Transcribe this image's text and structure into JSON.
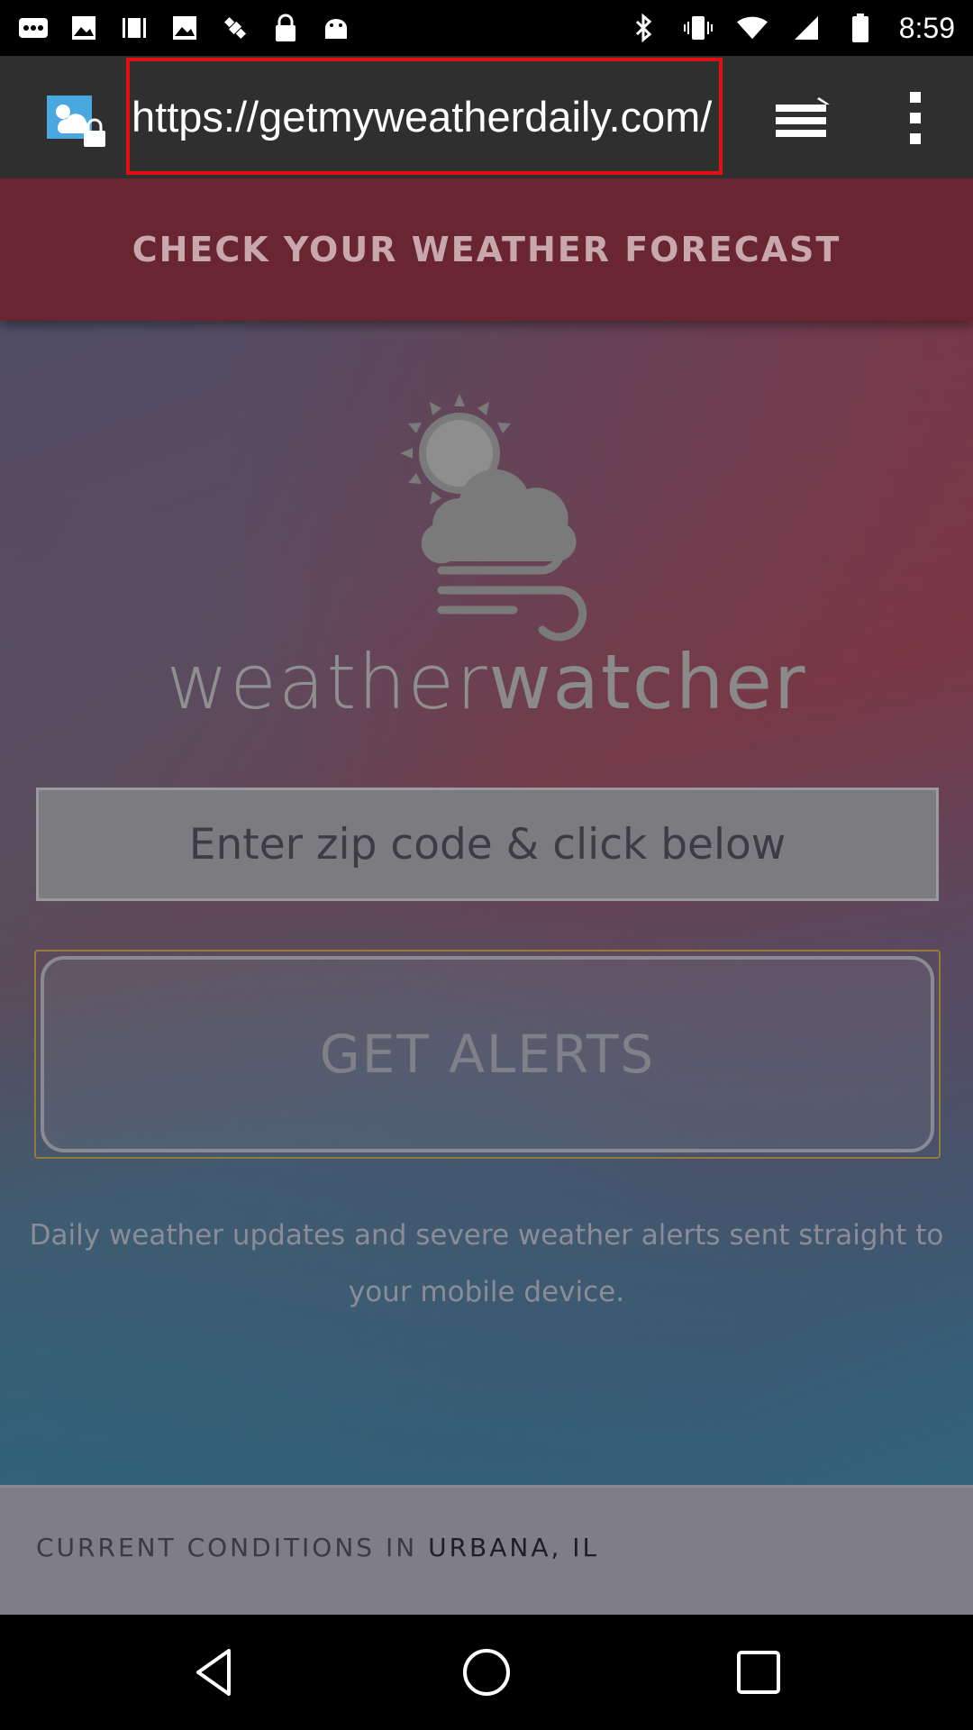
{
  "status_bar": {
    "time": "8:59",
    "icons_left": [
      "more-notifications-icon",
      "image-icon",
      "video-icon",
      "image-icon",
      "satellite-icon",
      "lock-icon",
      "android-icon"
    ],
    "icons_right": [
      "bluetooth-icon",
      "vibrate-icon",
      "wifi-icon",
      "signal-icon",
      "battery-icon"
    ]
  },
  "browser": {
    "url": "https://getmyweatherdaily.com/",
    "highlight_color": "#e01010"
  },
  "page": {
    "banner_text": "CHECK YOUR WEATHER FORECAST",
    "brand_light": "weather",
    "brand_bold": "watcher",
    "zip_placeholder": "Enter zip code & click below",
    "alerts_button": "GET ALERTS",
    "description_line1": "Daily weather updates and severe weather alerts sent straight to",
    "description_line2": "your mobile device.",
    "conditions_label": "CURRENT CONDITIONS IN ",
    "conditions_city": "URBANA, IL"
  },
  "colors": {
    "banner": "#6a2630",
    "toolbar": "#2f2f2f"
  }
}
